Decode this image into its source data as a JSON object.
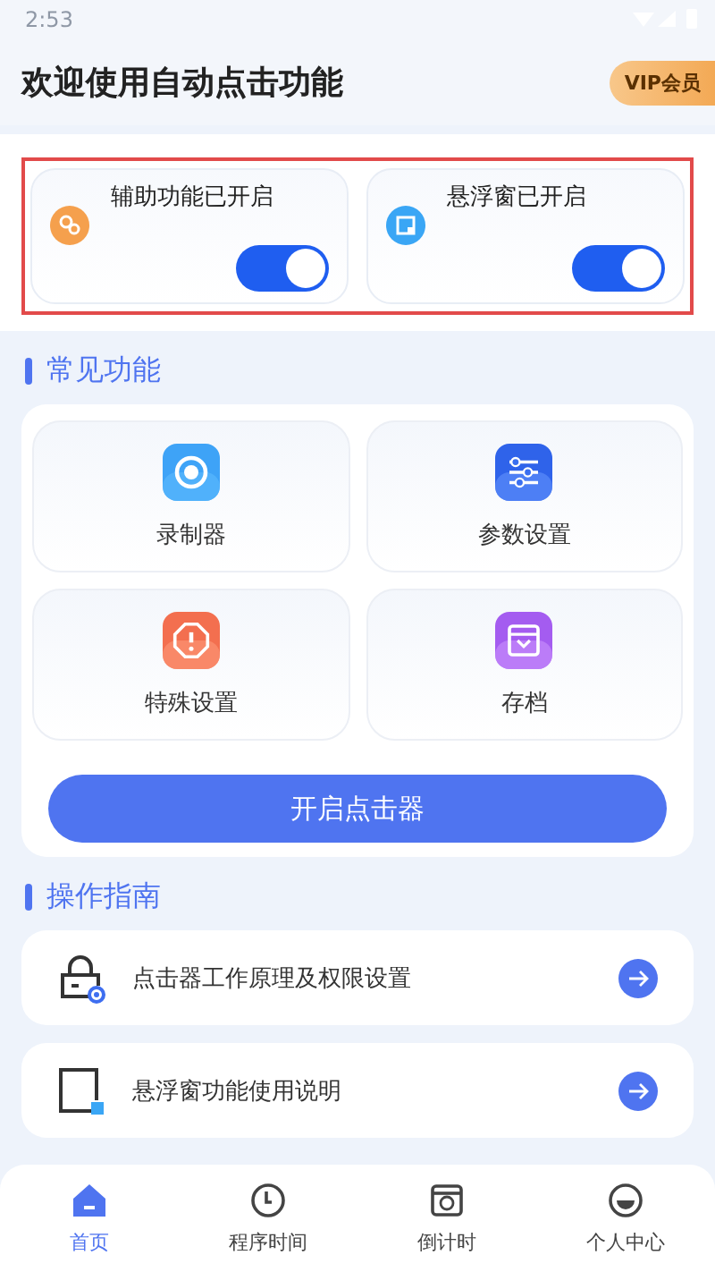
{
  "status_bar": {
    "time": "2:53"
  },
  "header": {
    "title": "欢迎使用自动点击功能",
    "badge": "VIP会员"
  },
  "toggles": [
    {
      "label": "辅助功能已开启",
      "on": true,
      "kind": "accessibility"
    },
    {
      "label": "悬浮窗已开启",
      "on": true,
      "kind": "floating"
    }
  ],
  "common": {
    "heading": "常见功能",
    "items": [
      {
        "label": "录制器",
        "kind": "record"
      },
      {
        "label": "参数设置",
        "kind": "params"
      },
      {
        "label": "特殊设置",
        "kind": "special"
      },
      {
        "label": "存档",
        "kind": "archive"
      }
    ],
    "button": "开启点击器"
  },
  "guide": {
    "heading": "操作指南",
    "items": [
      {
        "label": "点击器工作原理及权限设置",
        "kind": "lock"
      },
      {
        "label": "悬浮窗功能使用说明",
        "kind": "window"
      }
    ]
  },
  "tabs": [
    {
      "label": "首页",
      "selected": true,
      "kind": "home"
    },
    {
      "label": "程序时间",
      "selected": false,
      "kind": "clock"
    },
    {
      "label": "倒计时",
      "selected": false,
      "kind": "timer"
    },
    {
      "label": "个人中心",
      "selected": false,
      "kind": "user"
    }
  ]
}
